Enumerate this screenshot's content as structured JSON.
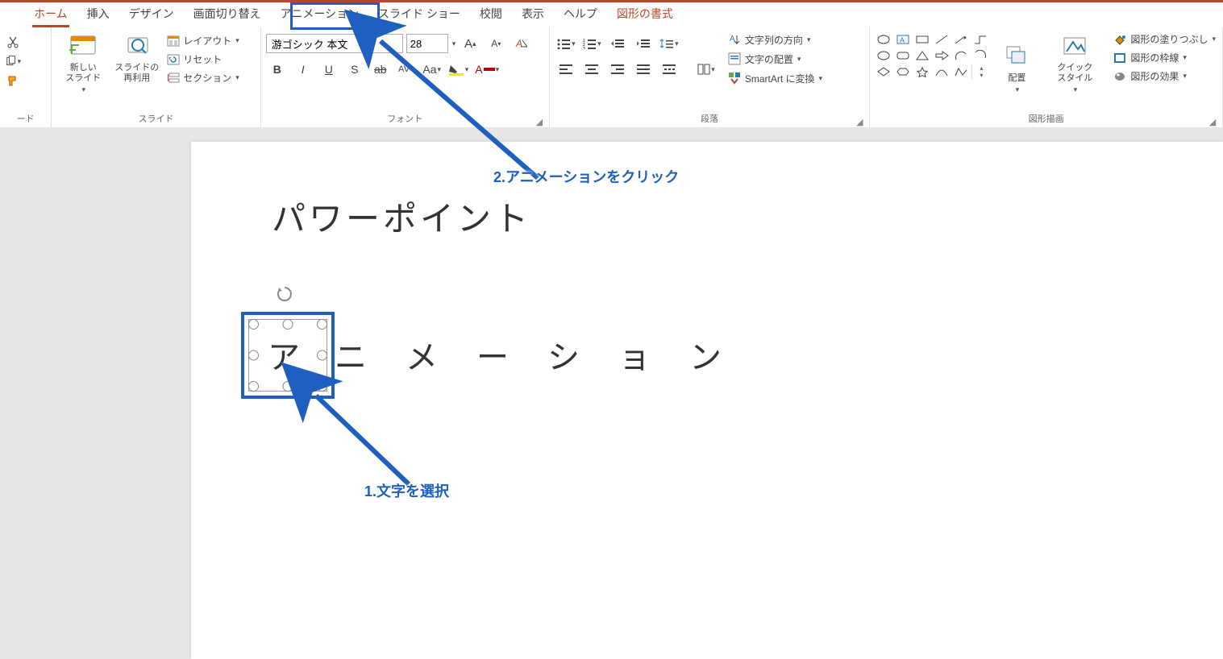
{
  "tabs": {
    "home": "ホーム",
    "insert": "挿入",
    "design": "デザイン",
    "transition": "画面切り替え",
    "animation": "アニメーション",
    "slideshow": "スライド ショー",
    "review": "校閲",
    "view": "表示",
    "help": "ヘルプ",
    "format": "図形の書式"
  },
  "groups": {
    "clipboard": "ード",
    "slide": "スライド",
    "font": "フォント",
    "paragraph": "段落",
    "drawing": "図形描画"
  },
  "slide_group": {
    "new_slide": "新しい\nスライド",
    "reuse": "スライドの\n再利用",
    "layout": "レイアウト",
    "reset": "リセット",
    "section": "セクション"
  },
  "font": {
    "name": "游ゴシック 本文",
    "size": "28"
  },
  "paragraph_side": {
    "text_dir": "文字列の方向",
    "text_align": "文字の配置",
    "smartart": "SmartArt に変換"
  },
  "drawing": {
    "arrange": "配置",
    "quick_style": "クイック\nスタイル",
    "fill": "図形の塗りつぶし",
    "outline": "図形の枠線",
    "effects": "図形の効果"
  },
  "slide_content": {
    "title": "パワーポイント",
    "body_chars": [
      "ア",
      "ニ",
      "メ",
      "ー",
      "シ",
      "ョ",
      "ン"
    ]
  },
  "annotations": {
    "step2": "2.アニメーションをクリック",
    "step1": "1.文字を選択"
  }
}
